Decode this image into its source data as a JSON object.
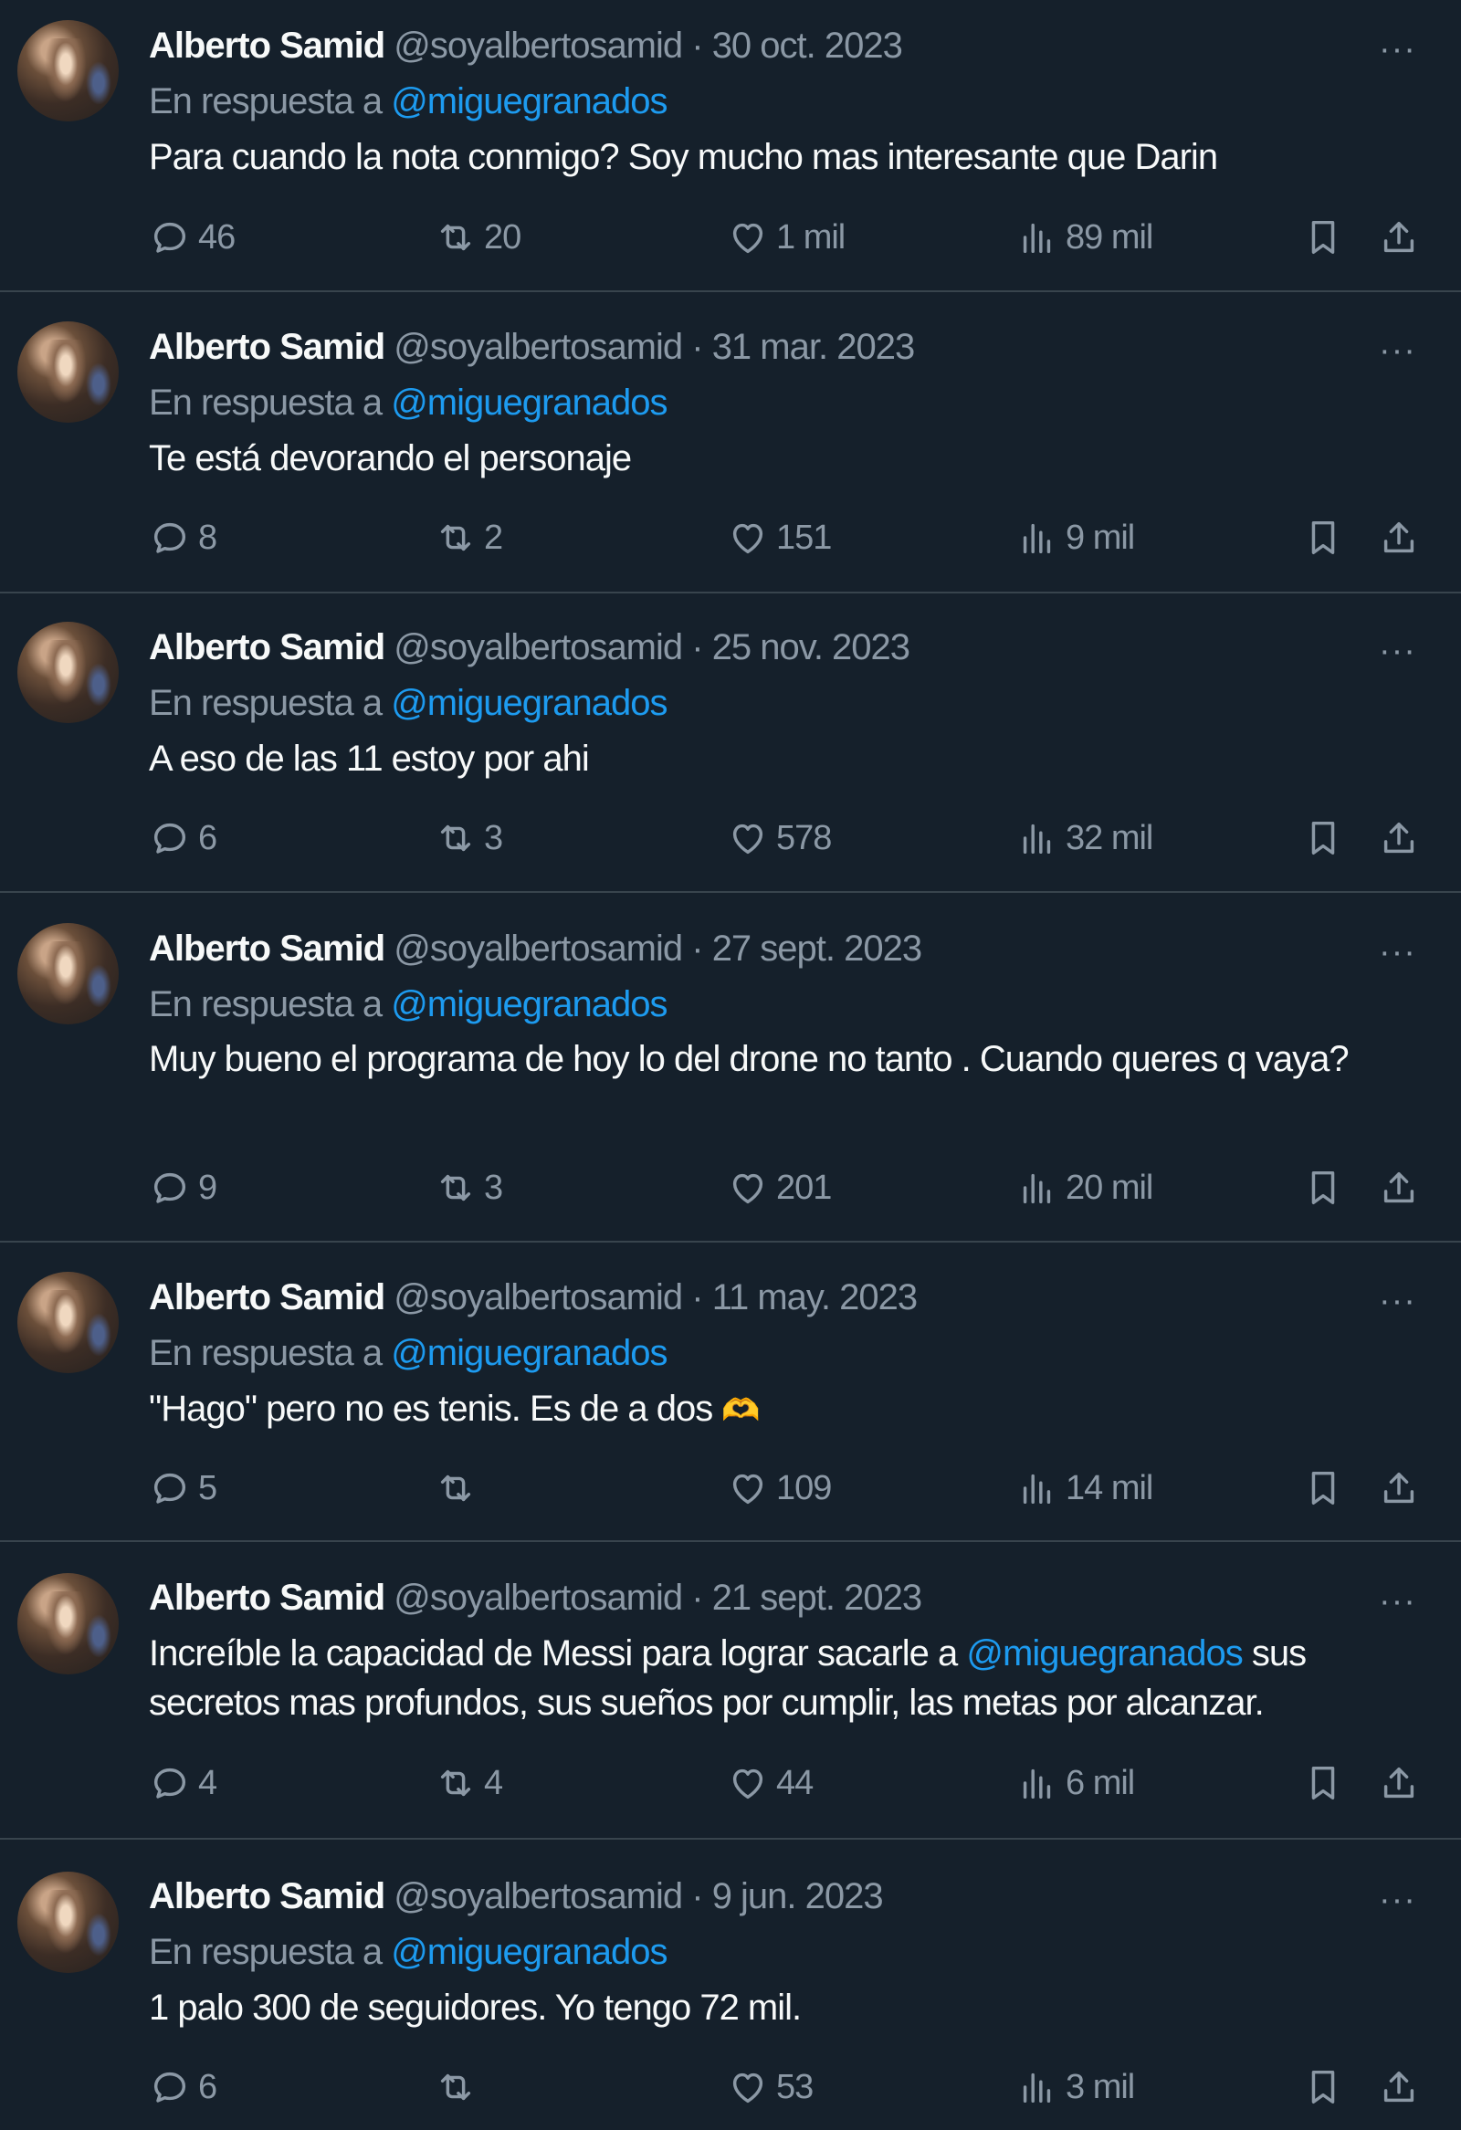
{
  "tweets": [
    {
      "name": "Alberto Samid",
      "handle": "@soyalbertosamid",
      "date": "30 oct. 2023",
      "reply_prefix": "En respuesta a",
      "reply_to": "@miguegranados",
      "text": "Para cuando la nota conmigo? Soy mucho mas interesante que Darin",
      "replies": "46",
      "reposts": "20",
      "likes": "1 mil",
      "views": "89 mil"
    },
    {
      "name": "Alberto Samid",
      "handle": "@soyalbertosamid",
      "date": "31 mar. 2023",
      "reply_prefix": "En respuesta a",
      "reply_to": "@miguegranados",
      "text": "Te está devorando el personaje",
      "replies": "8",
      "reposts": "2",
      "likes": "151",
      "views": "9 mil"
    },
    {
      "name": "Alberto Samid",
      "handle": "@soyalbertosamid",
      "date": "25 nov. 2023",
      "reply_prefix": "En respuesta a",
      "reply_to": "@miguegranados",
      "text": "A eso de las 11 estoy por ahi",
      "replies": "6",
      "reposts": "3",
      "likes": "578",
      "views": "32 mil"
    },
    {
      "name": "Alberto Samid",
      "handle": "@soyalbertosamid",
      "date": "27 sept. 2023",
      "reply_prefix": "En respuesta a",
      "reply_to": "@miguegranados",
      "text": "Muy bueno el programa de hoy lo del drone no tanto . Cuando queres q vaya?",
      "replies": "9",
      "reposts": "3",
      "likes": "201",
      "views": "20 mil"
    },
    {
      "name": "Alberto Samid",
      "handle": "@soyalbertosamid",
      "date": "11 may. 2023",
      "reply_prefix": "En respuesta a",
      "reply_to": "@miguegranados",
      "text": "\"Hago\" pero no es tenis. Es de a dos",
      "emoji": "🫶",
      "replies": "5",
      "reposts": "",
      "likes": "109",
      "views": "14 mil"
    },
    {
      "name": "Alberto Samid",
      "handle": "@soyalbertosamid",
      "date": "21 sept. 2023",
      "text_before": "Increíble la capacidad de Messi para lograr sacarle a",
      "mention": "@miguegranados",
      "text_after": "sus secretos mas profundos, sus sueños por cumplir, las metas por alcanzar.",
      "replies": "4",
      "reposts": "4",
      "likes": "44",
      "views": "6 mil"
    },
    {
      "name": "Alberto Samid",
      "handle": "@soyalbertosamid",
      "date": "9 jun. 2023",
      "reply_prefix": "En respuesta a",
      "reply_to": "@miguegranados",
      "text": "1 palo 300 de seguidores. Yo tengo 72 mil.",
      "replies": "6",
      "reposts": "",
      "likes": "53",
      "views": "3 mil"
    }
  ],
  "more_label": "···",
  "separator": " · ",
  "icons": {
    "reply": "reply-icon",
    "repost": "repost-icon",
    "like": "heart-icon",
    "views": "views-icon",
    "bookmark": "bookmark-icon",
    "share": "share-icon"
  },
  "colors": {
    "background": "#15202b",
    "text": "#f7f9f9",
    "secondary": "#8b98a5",
    "link": "#1d9bf0",
    "divider": "#38444d"
  }
}
